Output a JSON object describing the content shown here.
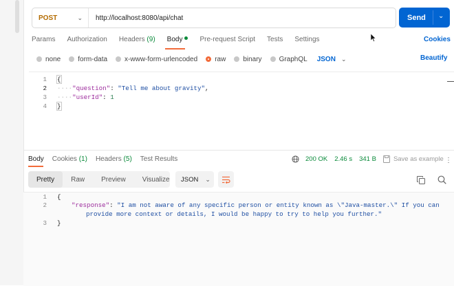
{
  "request": {
    "method": "POST",
    "url": "http://localhost:8080/api/chat",
    "send_label": "Send"
  },
  "request_tabs": [
    {
      "label": "Params"
    },
    {
      "label": "Authorization"
    },
    {
      "label": "Headers",
      "count": "(9)"
    },
    {
      "label": "Body",
      "active": true
    },
    {
      "label": "Pre-request Script"
    },
    {
      "label": "Tests"
    },
    {
      "label": "Settings"
    }
  ],
  "cookies_label": "Cookies",
  "body_types": {
    "options": [
      "none",
      "form-data",
      "x-www-form-urlencoded",
      "raw",
      "binary",
      "GraphQL"
    ],
    "selected": "raw",
    "language": "JSON"
  },
  "beautify_label": "Beautify",
  "request_body": {
    "line_numbers": [
      "1",
      "2",
      "3",
      "4"
    ],
    "lines": [
      {
        "open": "{"
      },
      {
        "key": "\"question\"",
        "colon": ": ",
        "value": "\"Tell me about gravity\"",
        "comma": ","
      },
      {
        "key": "\"userId\"",
        "colon": ": ",
        "value": "1"
      },
      {
        "close": "}"
      }
    ]
  },
  "response_tabs": [
    {
      "label": "Body",
      "active": true
    },
    {
      "label": "Cookies",
      "count": "(1)"
    },
    {
      "label": "Headers",
      "count": "(5)"
    },
    {
      "label": "Test Results"
    }
  ],
  "response_meta": {
    "status": "200 OK",
    "time": "2.46 s",
    "size": "341 B",
    "save_label": "Save as example"
  },
  "view_modes": {
    "options": [
      "Pretty",
      "Raw",
      "Preview",
      "Visualize"
    ],
    "selected": "Pretty",
    "language": "JSON"
  },
  "response_body": {
    "line_numbers": [
      "1",
      "2",
      "3"
    ],
    "open": "{",
    "key": "\"response\"",
    "colon": ": ",
    "value_line1": "\"I am not aware of any specific person or entity known as \\\"Java-master.\\\" If you can",
    "value_line2": "provide more context or details, I would be happy to try to help you further.\"",
    "close": "}"
  },
  "colors": {
    "send_button": "#0265d2",
    "method_post": "#b36b00",
    "status_ok": "#0a8a3a",
    "active_tab_underline": "#f26b3a",
    "json_key": "#9c2b9c",
    "json_string": "#1f4fa3"
  },
  "icons": [
    "chevron-down-icon",
    "globe-icon",
    "save-icon",
    "more-icon",
    "wrap-icon",
    "copy-icon",
    "search-icon",
    "cursor-pointer"
  ]
}
